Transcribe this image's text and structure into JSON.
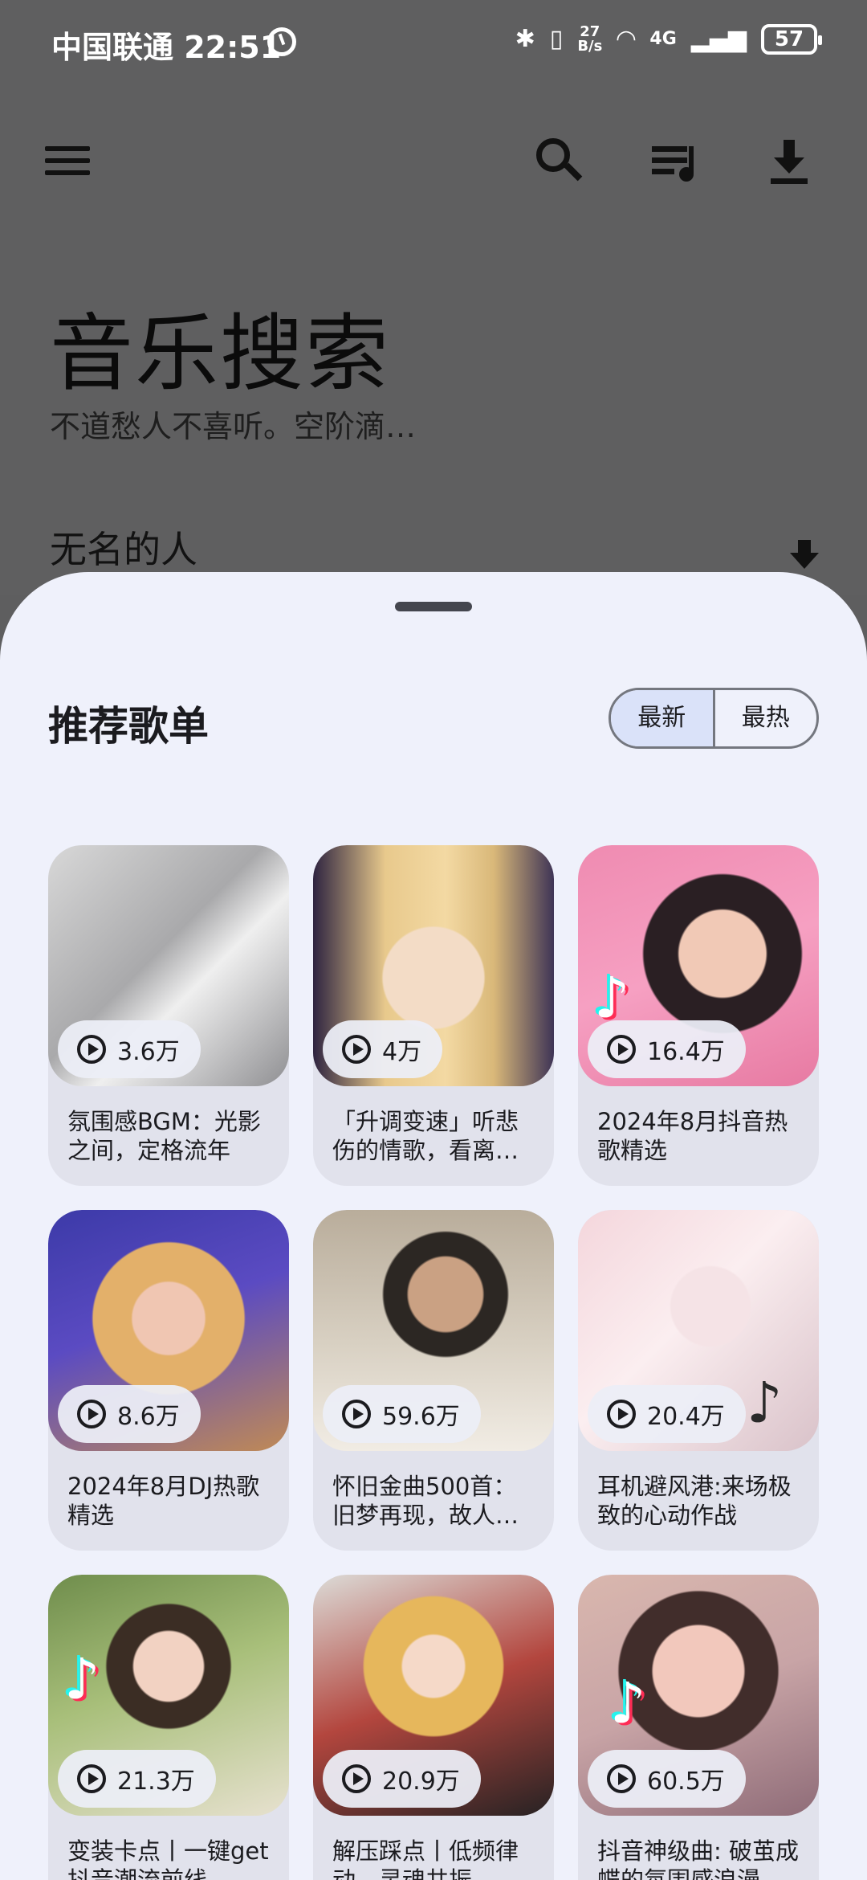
{
  "status_bar": {
    "carrier_time": "中国联通 22:51",
    "net_speed_value": "27",
    "net_speed_unit": "B/s",
    "signal": "4G",
    "battery": "57"
  },
  "header": {
    "title": "音乐搜索",
    "subtitle": "不道愁人不喜听。空阶滴…",
    "current_song": "无名的人"
  },
  "sheet": {
    "title": "推荐歌单",
    "sort_tabs": [
      {
        "label": "最新",
        "active": true
      },
      {
        "label": "最热",
        "active": false
      }
    ],
    "playlists": [
      {
        "count": "3.6万",
        "title": "氛围感BGM：光影之间，定格流年"
      },
      {
        "count": "4万",
        "title": "「升调变速」听悲伤的情歌，看离…"
      },
      {
        "count": "16.4万",
        "title": "2024年8月抖音热歌精选"
      },
      {
        "count": "8.6万",
        "title": "2024年8月DJ热歌精选"
      },
      {
        "count": "59.6万",
        "title": "怀旧金曲500首：旧梦再现，故人…"
      },
      {
        "count": "20.4万",
        "title": "耳机避风港:来场极致的心动作战"
      },
      {
        "count": "21.3万",
        "title": "变装卡点丨一键get抖音潮流前线"
      },
      {
        "count": "20.9万",
        "title": "解压踩点丨低频律动，灵魂共振"
      },
      {
        "count": "60.5万",
        "title": "抖音神级曲: 破茧成蝶的氛围感浪漫"
      }
    ]
  },
  "icons": {
    "menu": "menu-icon",
    "search": "search-icon",
    "queue": "queue-music-icon",
    "download": "download-icon",
    "play": "play-circle-icon"
  }
}
